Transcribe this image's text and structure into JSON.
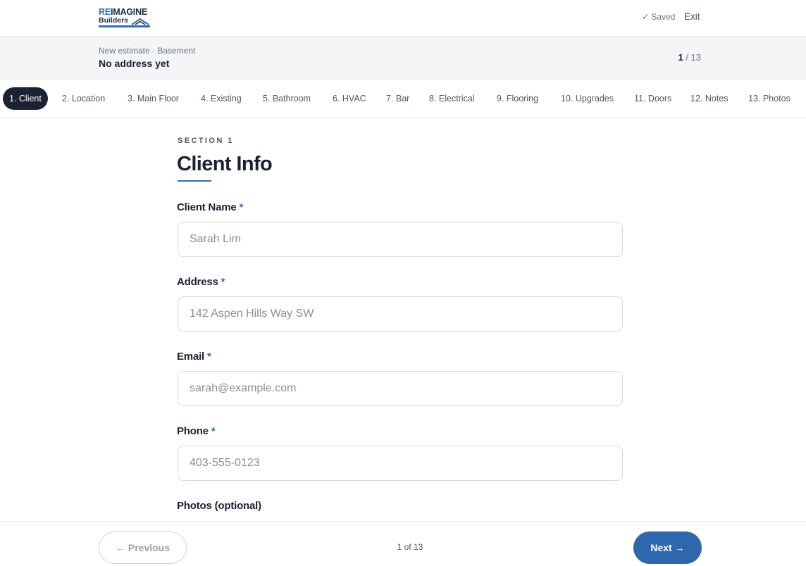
{
  "brand": {
    "logo_prefix": "RE",
    "logo_rest": "IMAGINE",
    "logo_line2": "Builders",
    "accent": "#2f6db5",
    "dark": "#1a2233"
  },
  "header": {
    "saved": "✓ Saved",
    "exit": "Exit"
  },
  "estimate": {
    "meta": "New estimate · Basement",
    "address": "No address yet",
    "current": "1",
    "total": "/ 13"
  },
  "tabs": [
    {
      "label": "1. Client",
      "active": true
    },
    {
      "label": "2. Location"
    },
    {
      "label": "3. Main Floor"
    },
    {
      "label": "4. Existing"
    },
    {
      "label": "5. Bathroom"
    },
    {
      "label": "6. HVAC"
    },
    {
      "label": "7. Bar"
    },
    {
      "label": "8. Electrical"
    },
    {
      "label": "9. Flooring"
    },
    {
      "label": "10. Upgrades"
    },
    {
      "label": "11. Doors"
    },
    {
      "label": "12. Notes"
    },
    {
      "label": "13. Photos"
    }
  ],
  "section": {
    "label": "SECTION 1",
    "title": "Client Info"
  },
  "fields": {
    "name": {
      "label": "Client Name",
      "required": "*",
      "value": "",
      "placeholder": "Sarah Lim"
    },
    "address": {
      "label": "Address",
      "required": "*",
      "value": "",
      "placeholder": "142 Aspen Hills Way SW"
    },
    "email": {
      "label": "Email",
      "required": "*",
      "value": "",
      "placeholder": "sarah@example.com"
    },
    "phone": {
      "label": "Phone",
      "required": "*",
      "value": "",
      "placeholder": "403-555-0123"
    },
    "photos": {
      "label": "Photos (optional)"
    }
  },
  "footer": {
    "previous": "← Previous",
    "page": "1 of 13",
    "next": "Next →"
  }
}
